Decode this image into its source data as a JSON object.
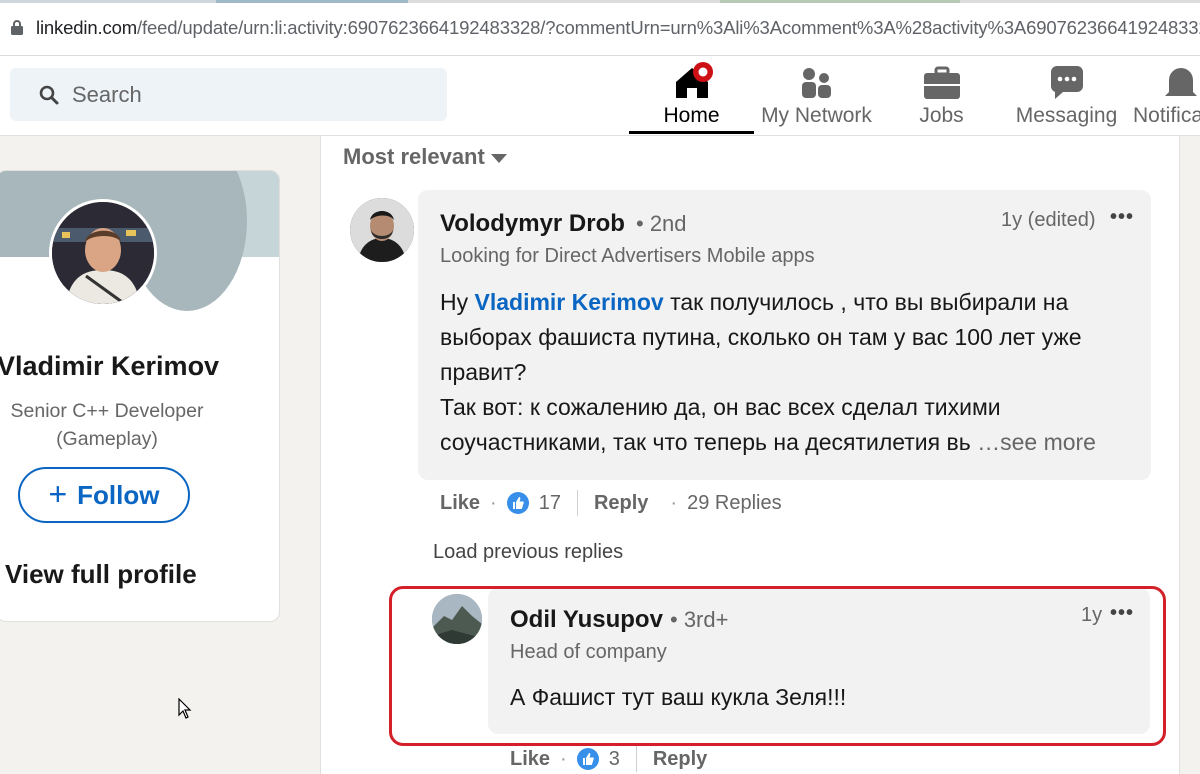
{
  "browser": {
    "url_host": "linkedin.com",
    "url_path": "/feed/update/urn:li:activity:6907623664192483328/?commentUrn=urn%3Ali%3Acomment%3A%28activity%3A6907623664192483328%2C"
  },
  "nav": {
    "search_placeholder": "Search",
    "items": [
      {
        "label": "Home",
        "icon": "home-icon",
        "active": true
      },
      {
        "label": "My Network",
        "icon": "network-icon"
      },
      {
        "label": "Jobs",
        "icon": "briefcase-icon"
      },
      {
        "label": "Messaging",
        "icon": "chat-icon"
      },
      {
        "label": "Notifica",
        "icon": "bell-icon"
      }
    ]
  },
  "profile": {
    "name": "Vladimir Kerimov",
    "headline": "Senior C++ Developer (Gameplay)",
    "follow_label": "Follow",
    "follow_plus": "+",
    "view_profile": "View full profile"
  },
  "feed": {
    "sort_label": "Most relevant",
    "comment": {
      "author": "Volodymyr Drob",
      "degree": "• 2nd",
      "time": "1y (edited)",
      "menu": "•••",
      "headline": "Looking for Direct Advertisers Mobile apps",
      "text_prefix": "Ну ",
      "mention": "Vladimir Kerimov",
      "text_line1_rest": " так получилось , что вы выбирали на",
      "text_line2": "выборах фашиста путина, сколько он там у вас 100 лет уже",
      "text_line3": "правит?",
      "text_line4": "Так вот: к сожалению да, он вас всех сделал тихими",
      "text_line5": "соучастниками, так что теперь на десятилетия вь",
      "see_more": "…see more",
      "like": "Like",
      "sep": "·",
      "reactions": "17",
      "reply": "Reply",
      "replies": "29 Replies"
    },
    "load_previous": "Load previous replies",
    "reply": {
      "author": "Odil Yusupov",
      "degree": "• 3rd+",
      "time": "1y",
      "menu": "•••",
      "headline": "Head of company",
      "text": "А Фашист тут ваш кукла Зеля!!!",
      "like": "Like",
      "sep": "·",
      "reactions": "3",
      "reply": "Reply"
    }
  },
  "colors": {
    "linkedin_blue": "#0a66c2",
    "highlight_red": "#d32029",
    "notification_red": "#cc1016"
  }
}
